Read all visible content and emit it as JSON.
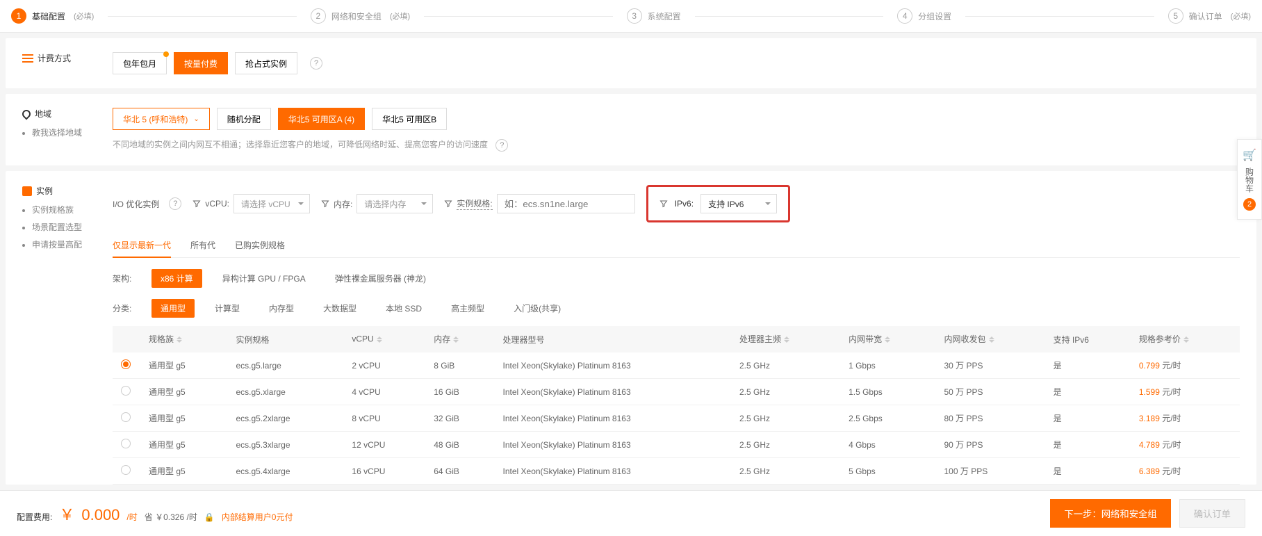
{
  "wizard": {
    "steps": [
      {
        "num": "1",
        "label": "基础配置",
        "req": "(必填)"
      },
      {
        "num": "2",
        "label": "网络和安全组",
        "req": "(必填)"
      },
      {
        "num": "3",
        "label": "系统配置",
        "req": ""
      },
      {
        "num": "4",
        "label": "分组设置",
        "req": ""
      },
      {
        "num": "5",
        "label": "确认订单",
        "req": "(必填)"
      }
    ]
  },
  "billing": {
    "title": "计费方式",
    "options": [
      "包年包月",
      "按量付费",
      "抢占式实例"
    ]
  },
  "region": {
    "title": "地域",
    "help_link": "教我选择地域",
    "selected": "华北 5 (呼和浩特)",
    "zones": [
      "随机分配",
      "华北5 可用区A (4)",
      "华北5 可用区B"
    ],
    "note": "不同地域的实例之间内网互不相通；选择靠近您客户的地域，可降低网络时延、提高您客户的访问速度"
  },
  "instance": {
    "title": "实例",
    "sublinks": [
      "实例规格族",
      "场景配置选型",
      "申请按量高配"
    ],
    "io_label": "I/O 优化实例",
    "filters": {
      "vcpu_label": "vCPU:",
      "vcpu_placeholder": "请选择 vCPU",
      "mem_label": "内存:",
      "mem_placeholder": "请选择内存",
      "spec_label": "实例规格:",
      "spec_placeholder": "如：ecs.sn1ne.large",
      "ipv6_label": "IPv6:",
      "ipv6_value": "支持 IPv6"
    },
    "gen_tabs": [
      "仅显示最新一代",
      "所有代",
      "已购实例规格"
    ],
    "arch_label": "架构:",
    "arch_options": [
      "x86 计算",
      "异构计算 GPU / FPGA",
      "弹性裸金属服务器 (神龙)"
    ],
    "cat_label": "分类:",
    "cat_options": [
      "通用型",
      "计算型",
      "内存型",
      "大数据型",
      "本地 SSD",
      "高主频型",
      "入门级(共享)"
    ],
    "table": {
      "headers": [
        "规格族",
        "实例规格",
        "vCPU",
        "内存",
        "处理器型号",
        "处理器主频",
        "内网带宽",
        "内网收发包",
        "支持 IPv6",
        "规格参考价"
      ],
      "rows": [
        {
          "family": "通用型 g5",
          "spec": "ecs.g5.large",
          "vcpu": "2 vCPU",
          "mem": "8 GiB",
          "cpu": "Intel Xeon(Skylake) Platinum 8163",
          "freq": "2.5 GHz",
          "bw": "1 Gbps",
          "pps": "30 万 PPS",
          "ipv6": "是",
          "price": "0.799",
          "unit": " 元/时",
          "checked": true
        },
        {
          "family": "通用型 g5",
          "spec": "ecs.g5.xlarge",
          "vcpu": "4 vCPU",
          "mem": "16 GiB",
          "cpu": "Intel Xeon(Skylake) Platinum 8163",
          "freq": "2.5 GHz",
          "bw": "1.5 Gbps",
          "pps": "50 万 PPS",
          "ipv6": "是",
          "price": "1.599",
          "unit": " 元/时",
          "checked": false
        },
        {
          "family": "通用型 g5",
          "spec": "ecs.g5.2xlarge",
          "vcpu": "8 vCPU",
          "mem": "32 GiB",
          "cpu": "Intel Xeon(Skylake) Platinum 8163",
          "freq": "2.5 GHz",
          "bw": "2.5 Gbps",
          "pps": "80 万 PPS",
          "ipv6": "是",
          "price": "3.189",
          "unit": " 元/时",
          "checked": false
        },
        {
          "family": "通用型 g5",
          "spec": "ecs.g5.3xlarge",
          "vcpu": "12 vCPU",
          "mem": "48 GiB",
          "cpu": "Intel Xeon(Skylake) Platinum 8163",
          "freq": "2.5 GHz",
          "bw": "4 Gbps",
          "pps": "90 万 PPS",
          "ipv6": "是",
          "price": "4.789",
          "unit": " 元/时",
          "checked": false
        },
        {
          "family": "通用型 g5",
          "spec": "ecs.g5.4xlarge",
          "vcpu": "16 vCPU",
          "mem": "64 GiB",
          "cpu": "Intel Xeon(Skylake) Platinum 8163",
          "freq": "2.5 GHz",
          "bw": "5 Gbps",
          "pps": "100 万 PPS",
          "ipv6": "是",
          "price": "6.389",
          "unit": " 元/时",
          "checked": false
        }
      ]
    }
  },
  "footer": {
    "cost_label": "配置费用:",
    "currency": "￥",
    "price": "0.000",
    "unit": "/时",
    "save_label": "省 ￥",
    "save_amount": "0.326",
    "save_unit": "/时",
    "internal_note": "内部结算用户0元付",
    "next": "下一步：网络和安全组",
    "confirm": "确认订单"
  },
  "cart": {
    "label": "购物车",
    "count": "2"
  }
}
